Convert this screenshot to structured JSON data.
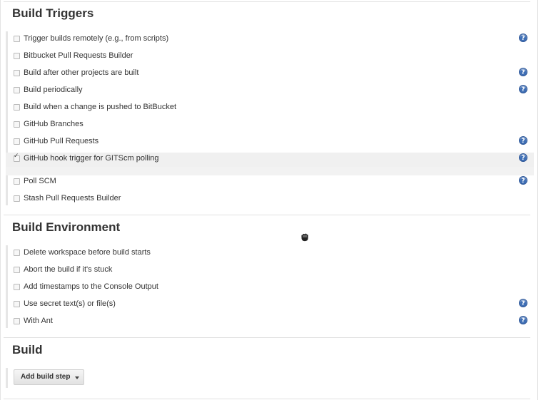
{
  "build_triggers": {
    "title": "Build Triggers",
    "items": [
      {
        "label": "Trigger builds remotely (e.g., from scripts)",
        "checked": false,
        "help": true
      },
      {
        "label": "Bitbucket Pull Requests Builder",
        "checked": false,
        "help": false
      },
      {
        "label": "Build after other projects are built",
        "checked": false,
        "help": true
      },
      {
        "label": "Build periodically",
        "checked": false,
        "help": true
      },
      {
        "label": "Build when a change is pushed to BitBucket",
        "checked": false,
        "help": false
      },
      {
        "label": "GitHub Branches",
        "checked": false,
        "help": false
      },
      {
        "label": "GitHub Pull Requests",
        "checked": false,
        "help": true
      },
      {
        "label": "GitHub hook trigger for GITScm polling",
        "checked": true,
        "help": true
      },
      {
        "label": "Poll SCM",
        "checked": false,
        "help": true
      },
      {
        "label": "Stash Pull Requests Builder",
        "checked": false,
        "help": false
      }
    ]
  },
  "build_environment": {
    "title": "Build Environment",
    "items": [
      {
        "label": "Delete workspace before build starts",
        "checked": false,
        "help": false
      },
      {
        "label": "Abort the build if it's stuck",
        "checked": false,
        "help": false
      },
      {
        "label": "Add timestamps to the Console Output",
        "checked": false,
        "help": false
      },
      {
        "label": "Use secret text(s) or file(s)",
        "checked": false,
        "help": true
      },
      {
        "label": "With Ant",
        "checked": false,
        "help": true
      }
    ]
  },
  "build": {
    "title": "Build",
    "add_step_label": "Add build step"
  },
  "help_glyph": "?",
  "icons": {
    "help": "question-circle-icon",
    "cursor": "hand-grab-cursor-icon"
  },
  "colors": {
    "help_blue": "#3f6fb5",
    "title": "#333333"
  }
}
